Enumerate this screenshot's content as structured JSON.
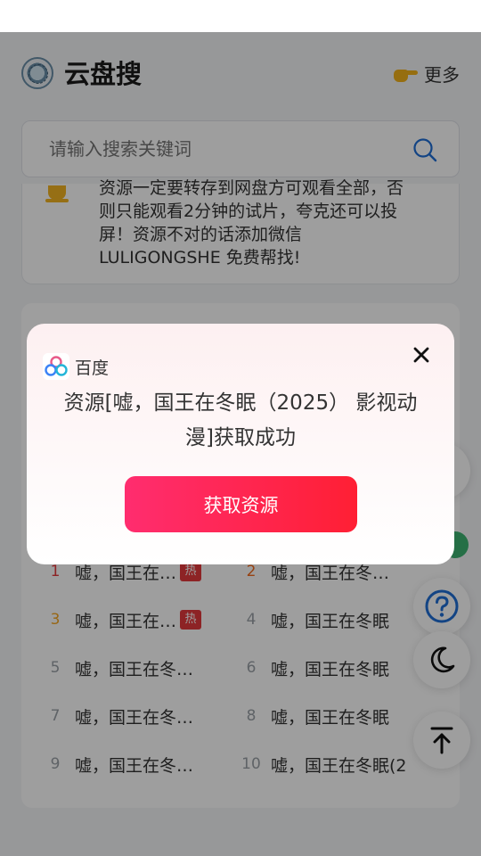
{
  "header": {
    "app_title": "云盘搜",
    "more_label": "更多"
  },
  "search": {
    "placeholder": "请输入搜索关键词"
  },
  "notice": {
    "text": "资源一定要转存到网盘方可观看全部，否则只能观看2分钟的试片，夸克还可以投屏！资源不对的话添加微信 LULIGONGSHE 免费帮找!"
  },
  "hot_list": [
    {
      "rank": "1",
      "title": "嘘，国王在…",
      "hot": "热"
    },
    {
      "rank": "2",
      "title": "嘘，国王在冬…",
      "hot": ""
    },
    {
      "rank": "3",
      "title": "嘘，国王在…",
      "hot": "热"
    },
    {
      "rank": "4",
      "title": "嘘，国王在冬眠",
      "hot": ""
    },
    {
      "rank": "5",
      "title": "嘘，国王在冬…",
      "hot": ""
    },
    {
      "rank": "6",
      "title": "嘘，国王在冬眠",
      "hot": ""
    },
    {
      "rank": "7",
      "title": "嘘，国王在冬…",
      "hot": ""
    },
    {
      "rank": "8",
      "title": "嘘，国王在冬眠",
      "hot": ""
    },
    {
      "rank": "9",
      "title": "嘘，国王在冬…",
      "hot": ""
    },
    {
      "rank": "10",
      "title": "嘘，国王在冬眠(2",
      "hot": ""
    }
  ],
  "modal": {
    "app_name": "百度",
    "message": "资源[嘘，国王在冬眠（2025） 影视动漫]获取成功",
    "button_label": "获取资源"
  },
  "icons": {
    "more": "pointing-hand-icon",
    "notice": "bell-icon",
    "search": "search-icon",
    "help": "question-icon",
    "dark_mode": "moon-icon",
    "top": "back-to-top-icon",
    "close": "close-icon"
  },
  "colors": {
    "primary_gradient_start": "#ff2d6f",
    "primary_gradient_end": "#ff1f34",
    "hot_badge": "#e4393c",
    "float_icon": "#1f6fd6"
  }
}
